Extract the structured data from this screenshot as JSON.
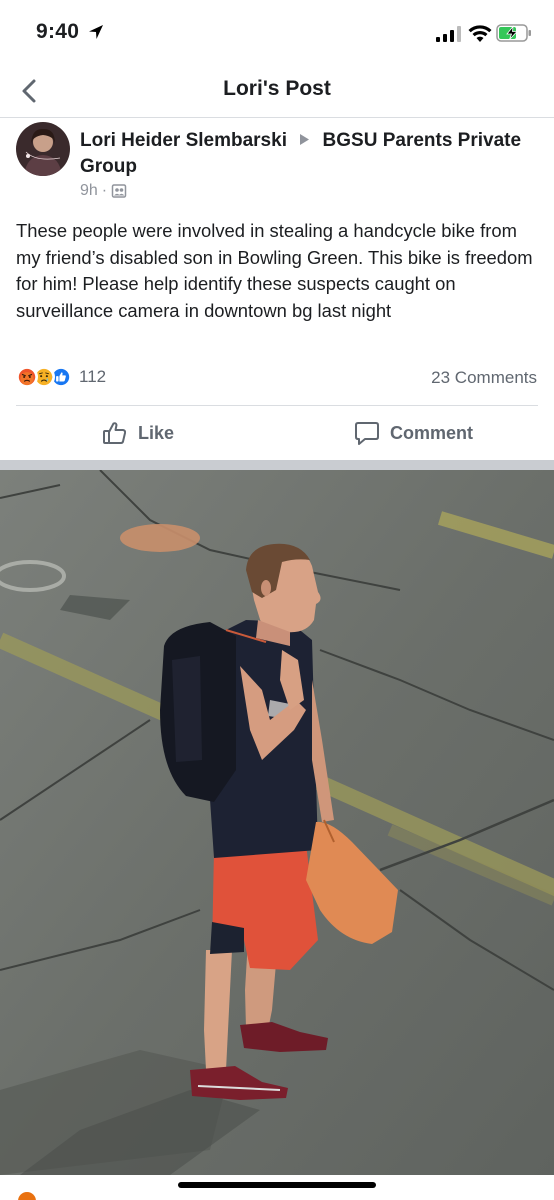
{
  "status_bar": {
    "time": "9:40",
    "location_icon": "location-arrow-icon",
    "signal_icon": "cellular-signal-icon",
    "wifi_icon": "wifi-icon",
    "battery_icon": "battery-charging-icon"
  },
  "nav": {
    "back_icon": "chevron-left-icon",
    "title": "Lori's Post"
  },
  "post": {
    "author": "Lori Heider Slembarski",
    "separator_icon": "triangle-right-icon",
    "group": "BGSU Parents Private Group",
    "time": "9h",
    "dot": "·",
    "privacy_icon": "group-icon",
    "text": "These people were involved in stealing a handcycle bike from my friend’s disabled son in Bowling Green.  This bike is freedom for him!  Please help identify these suspects caught on surveillance camera in downtown bg last night",
    "reactions": {
      "icons": [
        "angry-reaction-icon",
        "sad-reaction-icon",
        "like-reaction-icon"
      ],
      "count": "112"
    },
    "comments_count": "23 Comments",
    "actions": {
      "like_label": "Like",
      "comment_label": "Comment"
    }
  },
  "colors": {
    "text": "#1c1e21",
    "secondary_text": "#606770",
    "meta_text": "#90949c",
    "like_blue": "#1877f2",
    "angry_orange": "#f0542a",
    "sad_yellow": "#f7b125",
    "separator_gray": "#c9ccd1"
  }
}
